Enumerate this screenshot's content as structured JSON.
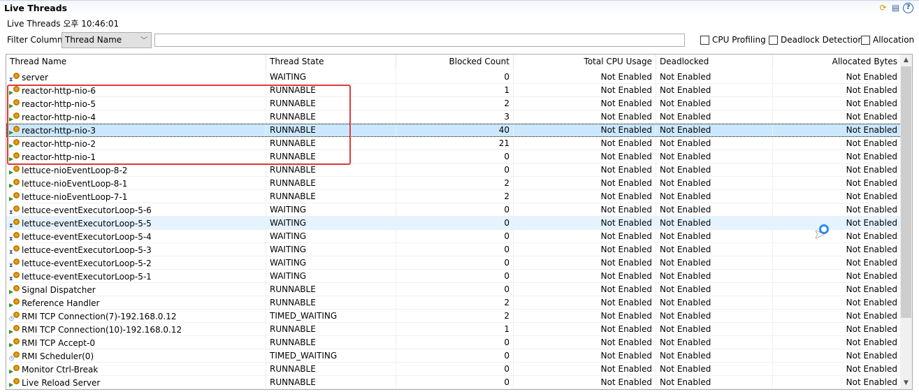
{
  "window": {
    "title": "Live Threads",
    "subtitle": "Live Threads 오후 10:46:01"
  },
  "toolbar": {
    "icons": [
      "refresh-icon",
      "table-icon",
      "help-icon"
    ]
  },
  "filter": {
    "label": "Filter Column",
    "selected": "Thread Name",
    "value": "",
    "options_visible": [
      "Thread Name"
    ]
  },
  "checkboxes": [
    {
      "label": "CPU Profiling",
      "checked": false
    },
    {
      "label": "Deadlock Detection",
      "checked": false
    },
    {
      "label": "Allocation",
      "checked": false
    }
  ],
  "columns": [
    "Thread Name",
    "Thread State",
    "Blocked Count",
    "Total CPU Usage",
    "Deadlocked",
    "Allocated Bytes"
  ],
  "rows": [
    [
      "server",
      "WAITING",
      "0",
      "Not Enabled",
      "Not Enabled",
      "Not Enabled"
    ],
    [
      "reactor-http-nio-6",
      "RUNNABLE",
      "1",
      "Not Enabled",
      "Not Enabled",
      "Not Enabled"
    ],
    [
      "reactor-http-nio-5",
      "RUNNABLE",
      "2",
      "Not Enabled",
      "Not Enabled",
      "Not Enabled"
    ],
    [
      "reactor-http-nio-4",
      "RUNNABLE",
      "3",
      "Not Enabled",
      "Not Enabled",
      "Not Enabled"
    ],
    [
      "reactor-http-nio-3",
      "RUNNABLE",
      "40",
      "Not Enabled",
      "Not Enabled",
      "Not Enabled"
    ],
    [
      "reactor-http-nio-2",
      "RUNNABLE",
      "21",
      "Not Enabled",
      "Not Enabled",
      "Not Enabled"
    ],
    [
      "reactor-http-nio-1",
      "RUNNABLE",
      "0",
      "Not Enabled",
      "Not Enabled",
      "Not Enabled"
    ],
    [
      "lettuce-nioEventLoop-8-2",
      "RUNNABLE",
      "0",
      "Not Enabled",
      "Not Enabled",
      "Not Enabled"
    ],
    [
      "lettuce-nioEventLoop-8-1",
      "RUNNABLE",
      "2",
      "Not Enabled",
      "Not Enabled",
      "Not Enabled"
    ],
    [
      "lettuce-nioEventLoop-7-1",
      "RUNNABLE",
      "2",
      "Not Enabled",
      "Not Enabled",
      "Not Enabled"
    ],
    [
      "lettuce-eventExecutorLoop-5-6",
      "WAITING",
      "0",
      "Not Enabled",
      "Not Enabled",
      "Not Enabled"
    ],
    [
      "lettuce-eventExecutorLoop-5-5",
      "WAITING",
      "0",
      "Not Enabled",
      "Not Enabled",
      "Not Enabled"
    ],
    [
      "lettuce-eventExecutorLoop-5-4",
      "WAITING",
      "0",
      "Not Enabled",
      "Not Enabled",
      "Not Enabled"
    ],
    [
      "lettuce-eventExecutorLoop-5-3",
      "WAITING",
      "0",
      "Not Enabled",
      "Not Enabled",
      "Not Enabled"
    ],
    [
      "lettuce-eventExecutorLoop-5-2",
      "WAITING",
      "0",
      "Not Enabled",
      "Not Enabled",
      "Not Enabled"
    ],
    [
      "lettuce-eventExecutorLoop-5-1",
      "WAITING",
      "0",
      "Not Enabled",
      "Not Enabled",
      "Not Enabled"
    ],
    [
      "Signal Dispatcher",
      "RUNNABLE",
      "0",
      "Not Enabled",
      "Not Enabled",
      "Not Enabled"
    ],
    [
      "Reference Handler",
      "RUNNABLE",
      "2",
      "Not Enabled",
      "Not Enabled",
      "Not Enabled"
    ],
    [
      "RMI TCP Connection(7)-192.168.0.12",
      "TIMED_WAITING",
      "2",
      "Not Enabled",
      "Not Enabled",
      "Not Enabled"
    ],
    [
      "RMI TCP Connection(10)-192.168.0.12",
      "RUNNABLE",
      "1",
      "Not Enabled",
      "Not Enabled",
      "Not Enabled"
    ],
    [
      "RMI TCP Accept-0",
      "RUNNABLE",
      "0",
      "Not Enabled",
      "Not Enabled",
      "Not Enabled"
    ],
    [
      "RMI Scheduler(0)",
      "TIMED_WAITING",
      "0",
      "Not Enabled",
      "Not Enabled",
      "Not Enabled"
    ],
    [
      "Monitor Ctrl-Break",
      "RUNNABLE",
      "0",
      "Not Enabled",
      "Not Enabled",
      "Not Enabled"
    ],
    [
      "Live Reload Server",
      "RUNNABLE",
      "0",
      "Not Enabled",
      "Not Enabled",
      "Not Enabled"
    ]
  ],
  "selected_row": 4,
  "hover_row": 11,
  "highlight_color": "#e03a3a"
}
